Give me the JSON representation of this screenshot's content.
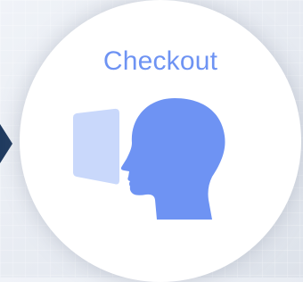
{
  "title": "Checkout",
  "icons": {
    "arrow": "arrow-right-icon",
    "card": "card-icon",
    "head": "head-profile-icon"
  },
  "colors": {
    "accent": "#6e93f3",
    "light_accent": "#c9d8fb",
    "arrow": "#1f3a5f",
    "card_bg": "#ffffff"
  }
}
